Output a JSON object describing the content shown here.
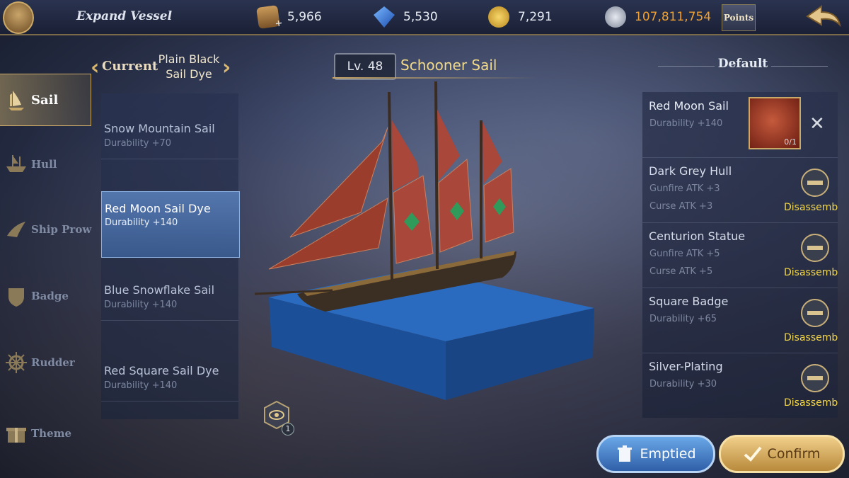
{
  "topbar": {
    "title": "Expand Vessel",
    "resources": [
      {
        "icon": "wood-crate-icon",
        "value": "5,966"
      },
      {
        "icon": "blue-gem-icon",
        "value": "5,530"
      },
      {
        "icon": "gold-coin-icon",
        "value": "7,291"
      },
      {
        "icon": "silver-coin-icon",
        "value": "107,811,754"
      }
    ],
    "points_label": "Points"
  },
  "sidebar": {
    "items": [
      {
        "label": "Sail",
        "icon": "sail-icon",
        "active": true
      },
      {
        "label": "Hull",
        "icon": "hull-icon",
        "active": false
      },
      {
        "label": "Ship Prow",
        "icon": "prow-icon",
        "active": false
      },
      {
        "label": "Badge",
        "icon": "badge-icon",
        "active": false
      },
      {
        "label": "Rudder",
        "icon": "rudder-icon",
        "active": false
      },
      {
        "label": "Theme",
        "icon": "theme-gift-icon",
        "active": false
      }
    ]
  },
  "current": {
    "label": "Current",
    "value": "Plain Black Sail Dye"
  },
  "sail_list": [
    {
      "name": "Snow Mountain Sail",
      "desc": "Durability +70"
    },
    {
      "name": "Red Moon Sail Dye",
      "desc": "Durability +140"
    },
    {
      "name": "Blue Snowflake Sail",
      "desc": "Durability +140"
    },
    {
      "name": "Red Square Sail Dye",
      "desc": "Durability +140"
    }
  ],
  "ship": {
    "level": "Lv. 48",
    "name": "Schooner Sail"
  },
  "eye_count": "1",
  "right_panel": {
    "header": "Default",
    "items": [
      {
        "name": "Red Moon Sail",
        "stat1": "Durability +140",
        "stat2": "",
        "thumb_count": "0/1"
      },
      {
        "name": "Dark Grey Hull",
        "stat1": "Gunfire ATK +3",
        "stat2": "Curse ATK +3",
        "action": "Disassemble"
      },
      {
        "name": "Centurion Statue",
        "stat1": "Gunfire ATK +5",
        "stat2": "Curse ATK +5",
        "action": "Disassemble"
      },
      {
        "name": "Square Badge",
        "stat1": "Durability +65",
        "stat2": "",
        "action": "Disassemble"
      },
      {
        "name": "Silver-Plating",
        "stat1": "Durability +30",
        "stat2": "",
        "action": "Disassemble"
      }
    ]
  },
  "buttons": {
    "emptied": "Emptied",
    "confirm": "Confirm"
  },
  "colors": {
    "gold_text": "#f0d98a",
    "silver_value": "#f0a030",
    "disassemble": "#f2d64a",
    "selected_row": "#4f7fc4"
  }
}
